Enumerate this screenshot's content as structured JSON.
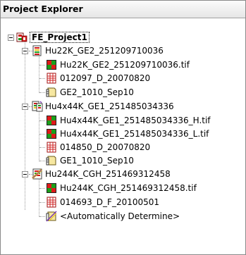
{
  "panel": {
    "title": "Project Explorer"
  },
  "tree": {
    "project": {
      "label": "FE_Project1",
      "icon": "project-icon"
    },
    "arrays": [
      {
        "label": "Hu22K_GE2_251209710036",
        "icon": "array-single-icon",
        "children": [
          {
            "label": "Hu22K_GE2_251209710036.tif",
            "icon": "tif-image-icon"
          },
          {
            "label": "012097_D_20070820",
            "icon": "grid-template-icon"
          },
          {
            "label": "GE2_1010_Sep10",
            "icon": "protocol-icon"
          }
        ]
      },
      {
        "label": "Hu4x44K_GE1_251485034336",
        "icon": "array-multi-icon",
        "children": [
          {
            "label": "Hu4x44K_GE1_251485034336_H.tif",
            "icon": "tif-image-icon"
          },
          {
            "label": "Hu4x44K_GE1_251485034336_L.tif",
            "icon": "tif-image-icon"
          },
          {
            "label": "014850_D_20070820",
            "icon": "grid-template-icon"
          },
          {
            "label": "GE1_1010_Sep10",
            "icon": "protocol-icon"
          }
        ]
      },
      {
        "label": "Hu244K_CGH_251469312458",
        "icon": "array-cgh-icon",
        "children": [
          {
            "label": "Hu244K_CGH_251469312458.tif",
            "icon": "tif-image-icon"
          },
          {
            "label": "014693_D_F_20100501",
            "icon": "grid-template-icon"
          },
          {
            "label": "<Automatically Determine>",
            "icon": "protocol-auto-icon"
          }
        ]
      }
    ]
  }
}
